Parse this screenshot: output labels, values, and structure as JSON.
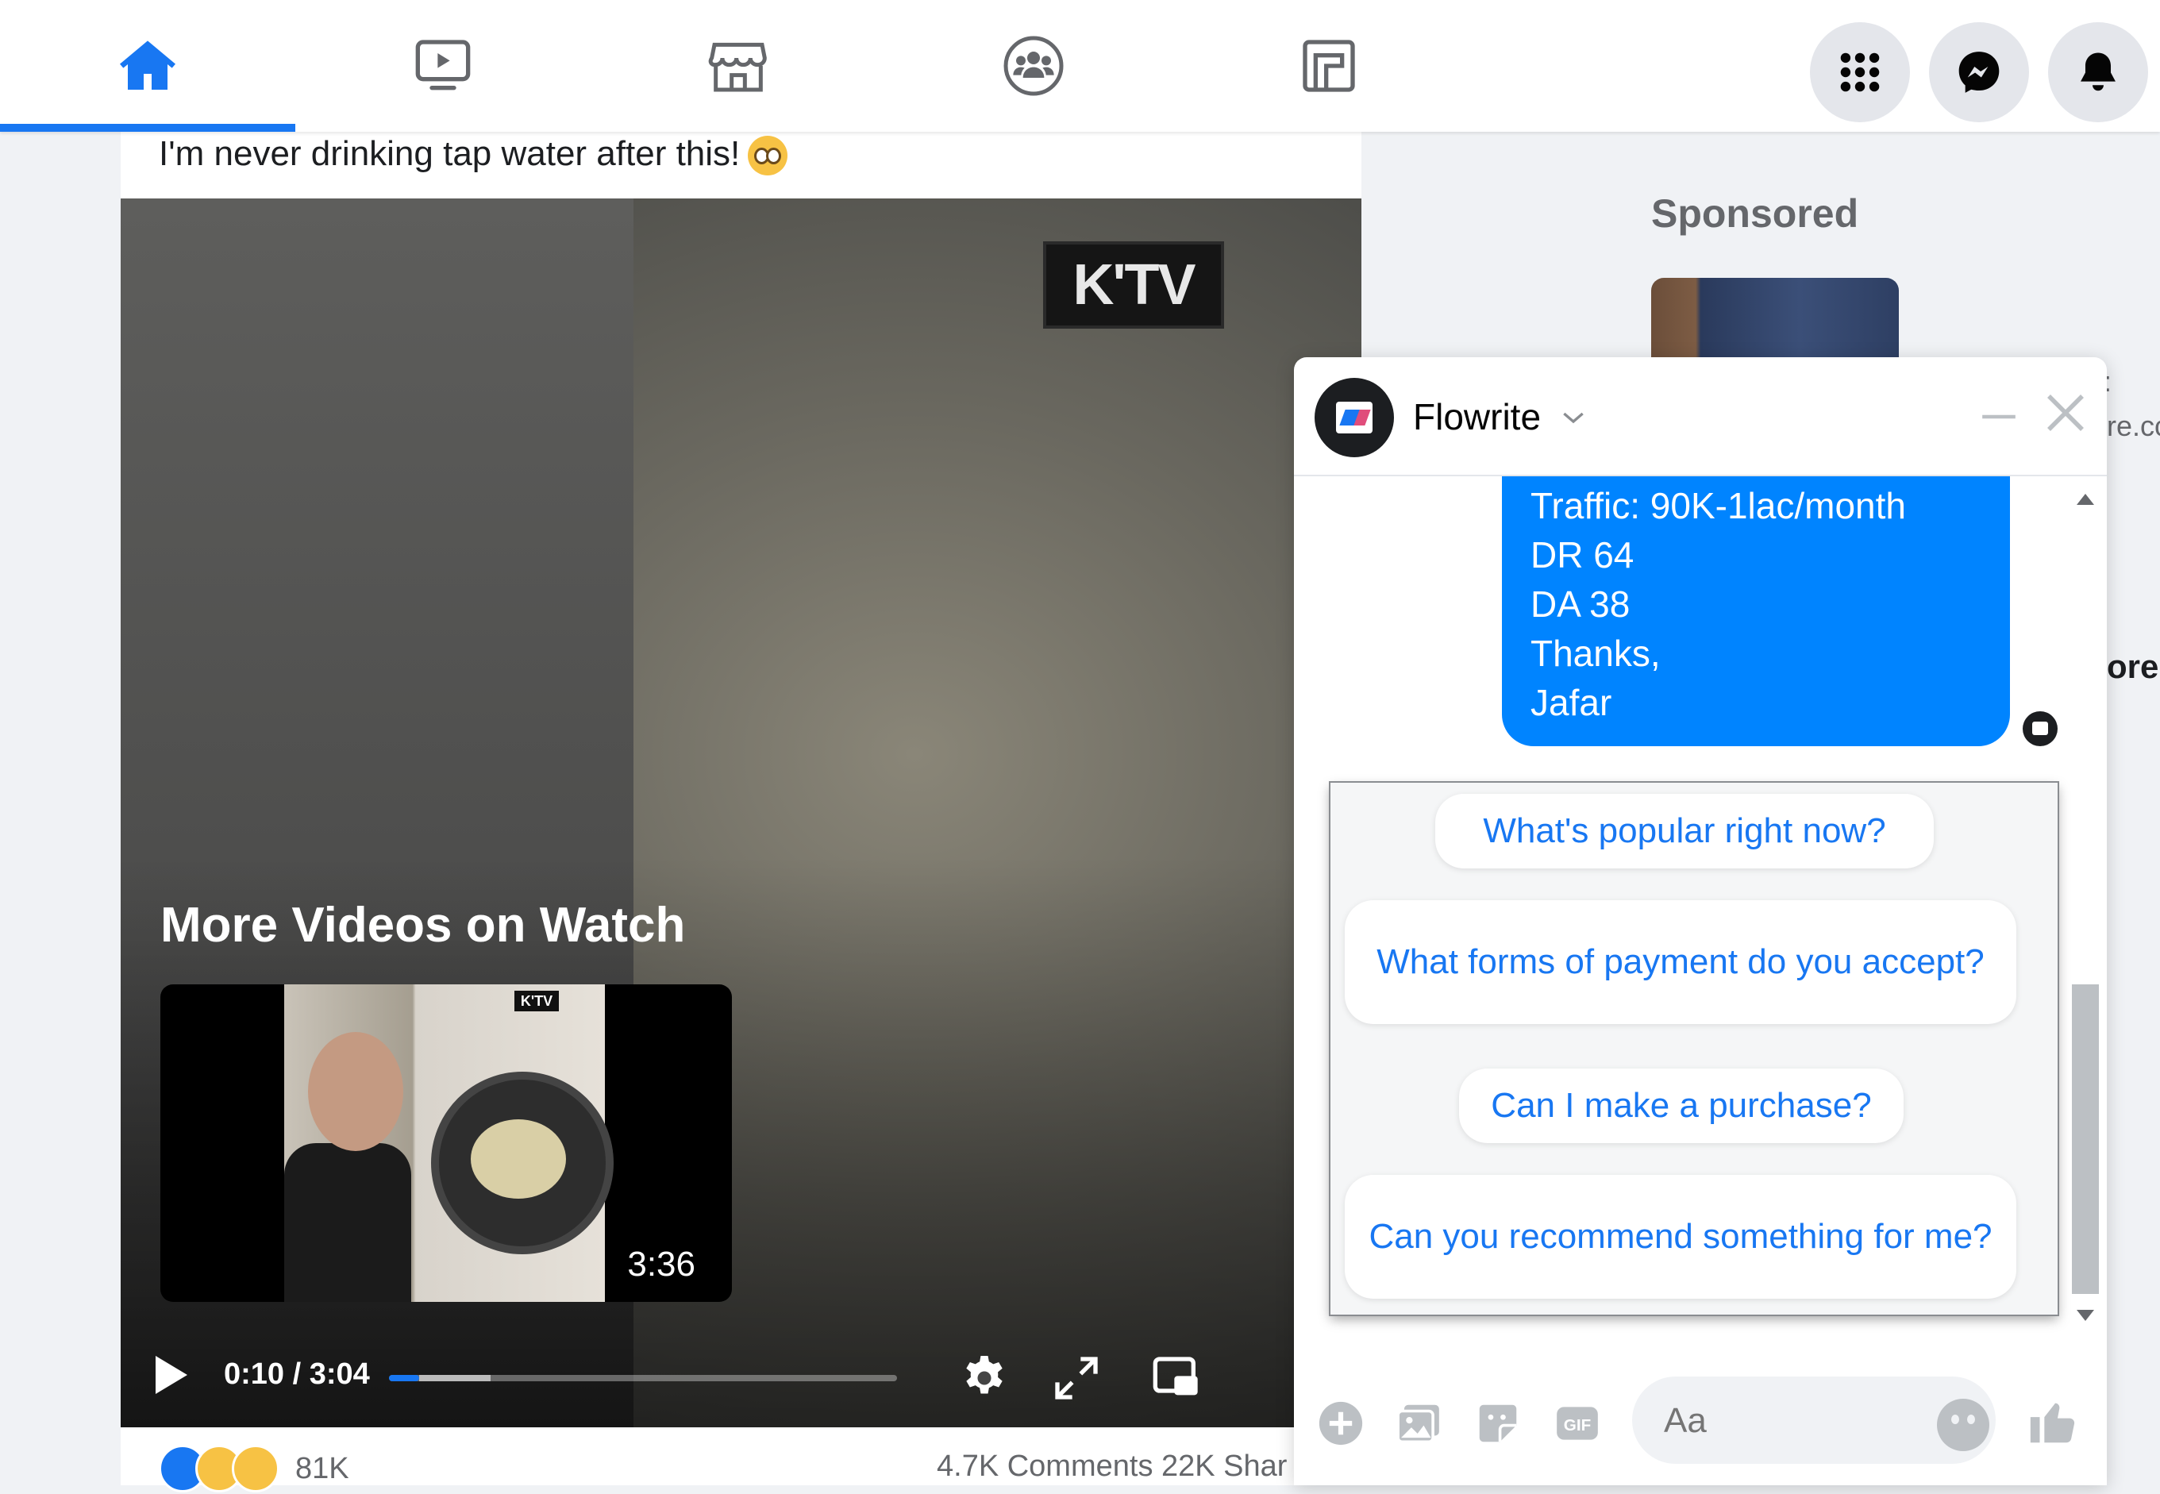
{
  "nav": {
    "tabs": [
      {
        "name": "home",
        "icon": "home-icon",
        "active": true
      },
      {
        "name": "watch",
        "icon": "watch-icon",
        "active": false
      },
      {
        "name": "marketplace",
        "icon": "marketplace-icon",
        "active": false
      },
      {
        "name": "groups",
        "icon": "groups-icon",
        "active": false
      },
      {
        "name": "gaming",
        "icon": "gaming-icon",
        "active": false
      }
    ],
    "right_buttons": [
      "menu-icon",
      "messenger-icon",
      "notifications-icon"
    ],
    "accent": "#1877f2"
  },
  "post": {
    "caption": "I'm never drinking tap water after this!",
    "video": {
      "watermark": "K'TV",
      "overlay_title": "More Videos on Watch",
      "suggested": {
        "duration": "3:36",
        "watermark": "K'TV"
      },
      "time": "0:10 / 3:04",
      "progress": 0.06
    },
    "reaction_count": "81K",
    "comments_shares": "4.7K Comments  22K Shar"
  },
  "right_column": {
    "sponsored": "Sponsored",
    "edge_url": "re.cc",
    "edge_more": "ore",
    "edge_colon": ":"
  },
  "chat": {
    "name": "Flowrite",
    "message_lines": [
      "Traffic: 90K-1lac/month",
      "DR 64",
      "DA 38",
      "Thanks,",
      "Jafar"
    ],
    "quick_replies": [
      "What's popular right now?",
      "What forms of payment do you accept?",
      "Can I make a purchase?",
      "Can you recommend something for me?"
    ],
    "input_placeholder": "Aa",
    "bubble_color": "#0084ff"
  }
}
